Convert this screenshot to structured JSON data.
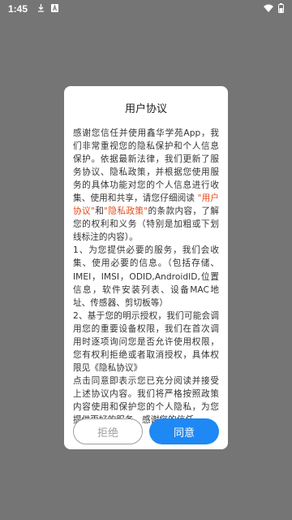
{
  "status_bar": {
    "time": "1:45",
    "icons": [
      "download-icon",
      "text-a-icon",
      "wifi-icon",
      "battery-icon"
    ]
  },
  "dialog": {
    "title": "用户协议",
    "paragraphs": {
      "p1_before": "感谢您信任并使用鑫华学苑App，我们非常重视您的隐私保护和个人信息保护。依据最新法律，我们更新了服务协议、隐私政策，并根据您使用服务的具体功能对您的个人信息进行收集、使用和共享，请您仔细阅读 ",
      "link_user_agreement": "\"用户协议\"",
      "p1_and": "和",
      "link_privacy_policy": "\"隐私政策\"",
      "p1_after": "的条款内容，了解您的权利和义务（特别是加粗或下划线标注的内容）。",
      "p2": " 1、为您提供必要的服务，我们会收集、使用必要的信息。（包括存储、IMEI，IMSI，ODID,AndroidID,位置信息，软件安装列表、设备MAC地址、传感器、剪切板等）",
      "p3": " 2、基于您的明示授权，我们可能会调用您的重要设备权限，我们在首次调用时逐项询问您是否允许使用权限，您有权利拒绝或者取消授权，具体权限见《隐私协议》",
      "p4": "点击同意即表示您已充分阅读并接受上述协议内容。我们将严格按照政策内容使用和保护您的个人隐私，为您提供更好的服务，感谢您的信任。"
    },
    "buttons": {
      "refuse_label": "拒绝",
      "agree_label": "同意"
    }
  },
  "colors": {
    "overlay": "#757575",
    "link": "#e64a19",
    "primary": "#1e88f5"
  }
}
